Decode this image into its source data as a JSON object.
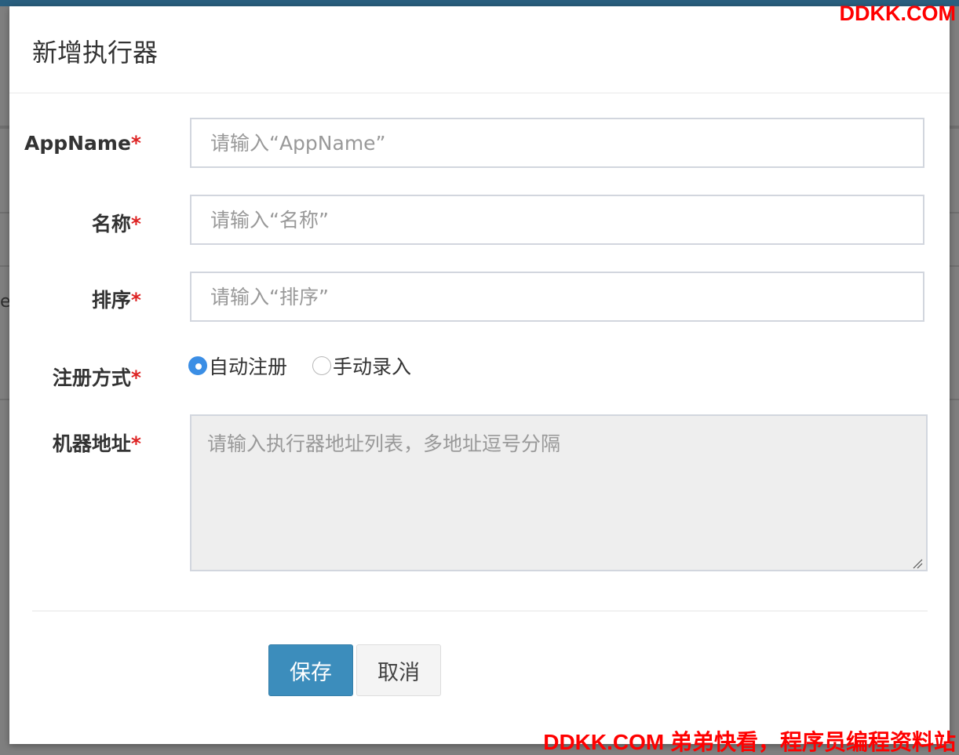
{
  "watermark": {
    "top": "DDKK.COM",
    "bottom": "DDKK.COM 弟弟快看，程序员编程资料站"
  },
  "background": {
    "partial_text": "e"
  },
  "modal": {
    "title": "新增执行器",
    "form": {
      "appname": {
        "label": "AppName",
        "required_mark": "*",
        "placeholder": "请输入“AppName”",
        "value": ""
      },
      "title": {
        "label": "名称",
        "required_mark": "*",
        "placeholder": "请输入“名称”",
        "value": ""
      },
      "order": {
        "label": "排序",
        "required_mark": "*",
        "placeholder": "请输入“排序”",
        "value": ""
      },
      "address_type": {
        "label": "注册方式",
        "required_mark": "*",
        "options": [
          {
            "label": "自动注册",
            "checked": true
          },
          {
            "label": "手动录入",
            "checked": false
          }
        ]
      },
      "address_list": {
        "label": "机器地址",
        "required_mark": "*",
        "placeholder": "请输入执行器地址列表，多地址逗号分隔",
        "value": "",
        "disabled": true
      }
    },
    "buttons": {
      "save": "保存",
      "cancel": "取消"
    }
  },
  "colors": {
    "primary": "#3c8dbc",
    "required": "#dd2222",
    "radio_checked": "#3b8ee5",
    "watermark": "#ff0000",
    "disabled_bg": "#eeeeee"
  }
}
